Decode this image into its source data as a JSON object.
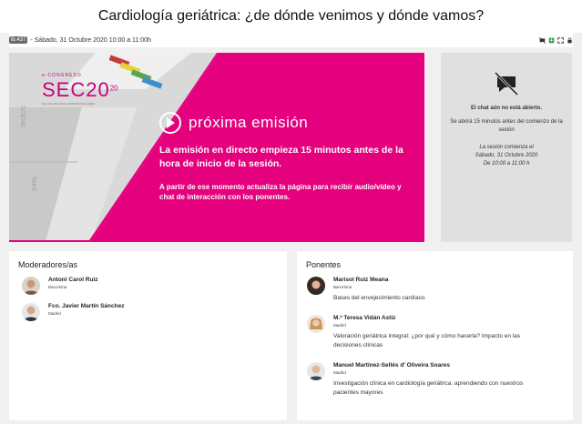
{
  "page": {
    "title": "Cardiología geriátrica: ¿de dónde venimos y dónde vamos?"
  },
  "infobar": {
    "tag": "lb.437",
    "date": "- Sábado, 31 Octubre 2020 10:00 a 11:00h"
  },
  "video": {
    "logo_small": "e-CONGRESO",
    "logo_big": "SEC20",
    "logo_sup": "20",
    "logo_tiny": "DE LAS CIENCIAS CARDIOVASCULARES",
    "clap_text_1": "SCENE",
    "clap_text_2": "TAKE",
    "proxima": "próxima emisión",
    "main_text": "La emisión en directo empieza 15 minutos antes de la hora de inicio de la sesión.",
    "sub_text": "A partir de ese momento actualiza la página para recibir audio/vídeo y chat de interacción con los ponentes."
  },
  "chat": {
    "title": "El chat aún no está abierto.",
    "text": "Se abrirá 15 minutos antes del comienzo de la sesión",
    "schedule_1": "La sesión comienza el",
    "schedule_2": "Sábado, 31 Octubre 2020",
    "schedule_3": "De 10:00 a 11:00 h"
  },
  "moderadores": {
    "heading": "Moderadores/as",
    "items": [
      {
        "name": "Antoni Carol Ruiz",
        "city": "Barcelona"
      },
      {
        "name": "Fco. Javier Martín Sánchez",
        "city": "Madrid"
      }
    ]
  },
  "ponentes": {
    "heading": "Ponentes",
    "items": [
      {
        "name": "Marisol Ruiz Meana",
        "city": "Barcelona",
        "talk": "Bases del envejecimiento cardíaco"
      },
      {
        "name": "M.ª Teresa Vidán Astiz",
        "city": "Madrid",
        "talk": "Valoración geriátrica integral: ¿por qué y cómo hacerla? Impacto en las decisiones clínicas"
      },
      {
        "name": "Manuel Martínez-Sellés d' Oliveira Soares",
        "city": "Madrid",
        "talk": "Investigación clínica en cardiología geriátrica: aprendiendo con nuestros pacientes mayores"
      }
    ]
  },
  "colors": {
    "accent": "#e5007e"
  }
}
